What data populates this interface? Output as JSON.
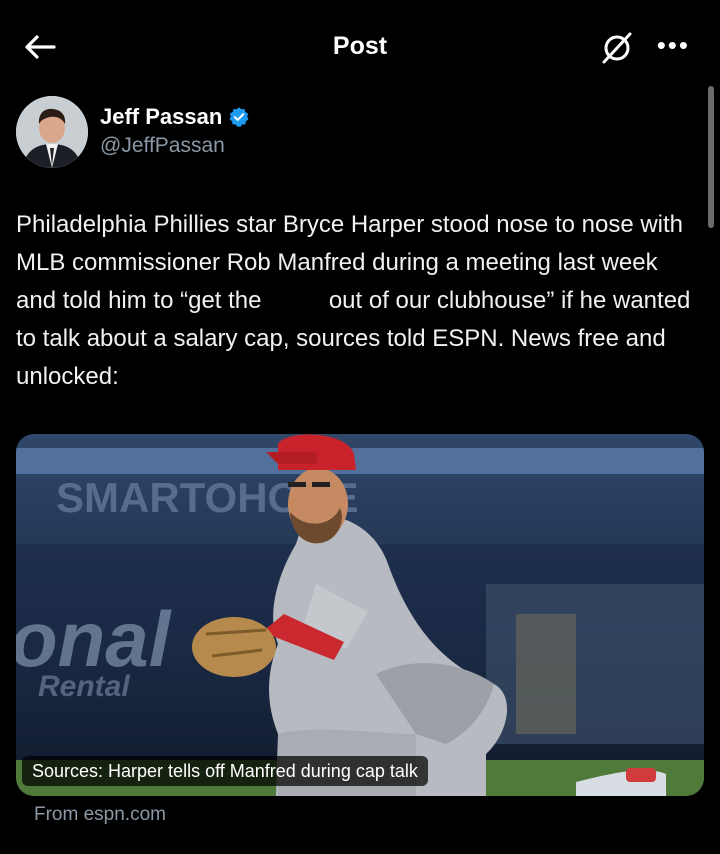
{
  "topbar": {
    "title": "Post",
    "back_icon": "arrow-left-icon",
    "grok_icon": "grok-icon",
    "more_icon": "more-horizontal-icon",
    "more_glyph": "•••"
  },
  "author": {
    "name": "Jeff Passan",
    "handle": "@JeffPassan",
    "verified": true
  },
  "tweet": {
    "text_before": "Philadelphia Phillies star Bryce Harper stood nose to nose with MLB commissioner Rob Manfred during a meeting last week and told him to “get the ",
    "text_after": " out of our clubhouse” if he wanted to talk about a salary cap, sources told ESPN. News free and unlocked:"
  },
  "link_card": {
    "caption": "Sources: Harper tells off Manfred during cap talk",
    "source": "From espn.com",
    "backdrop_text": "SMARTOHONE",
    "signage_text": "onal",
    "signage_sub": "Rental"
  },
  "colors": {
    "background": "#000000",
    "text": "#e7e9ea",
    "muted": "#8b98a5",
    "verified": "#1d9bf0"
  }
}
